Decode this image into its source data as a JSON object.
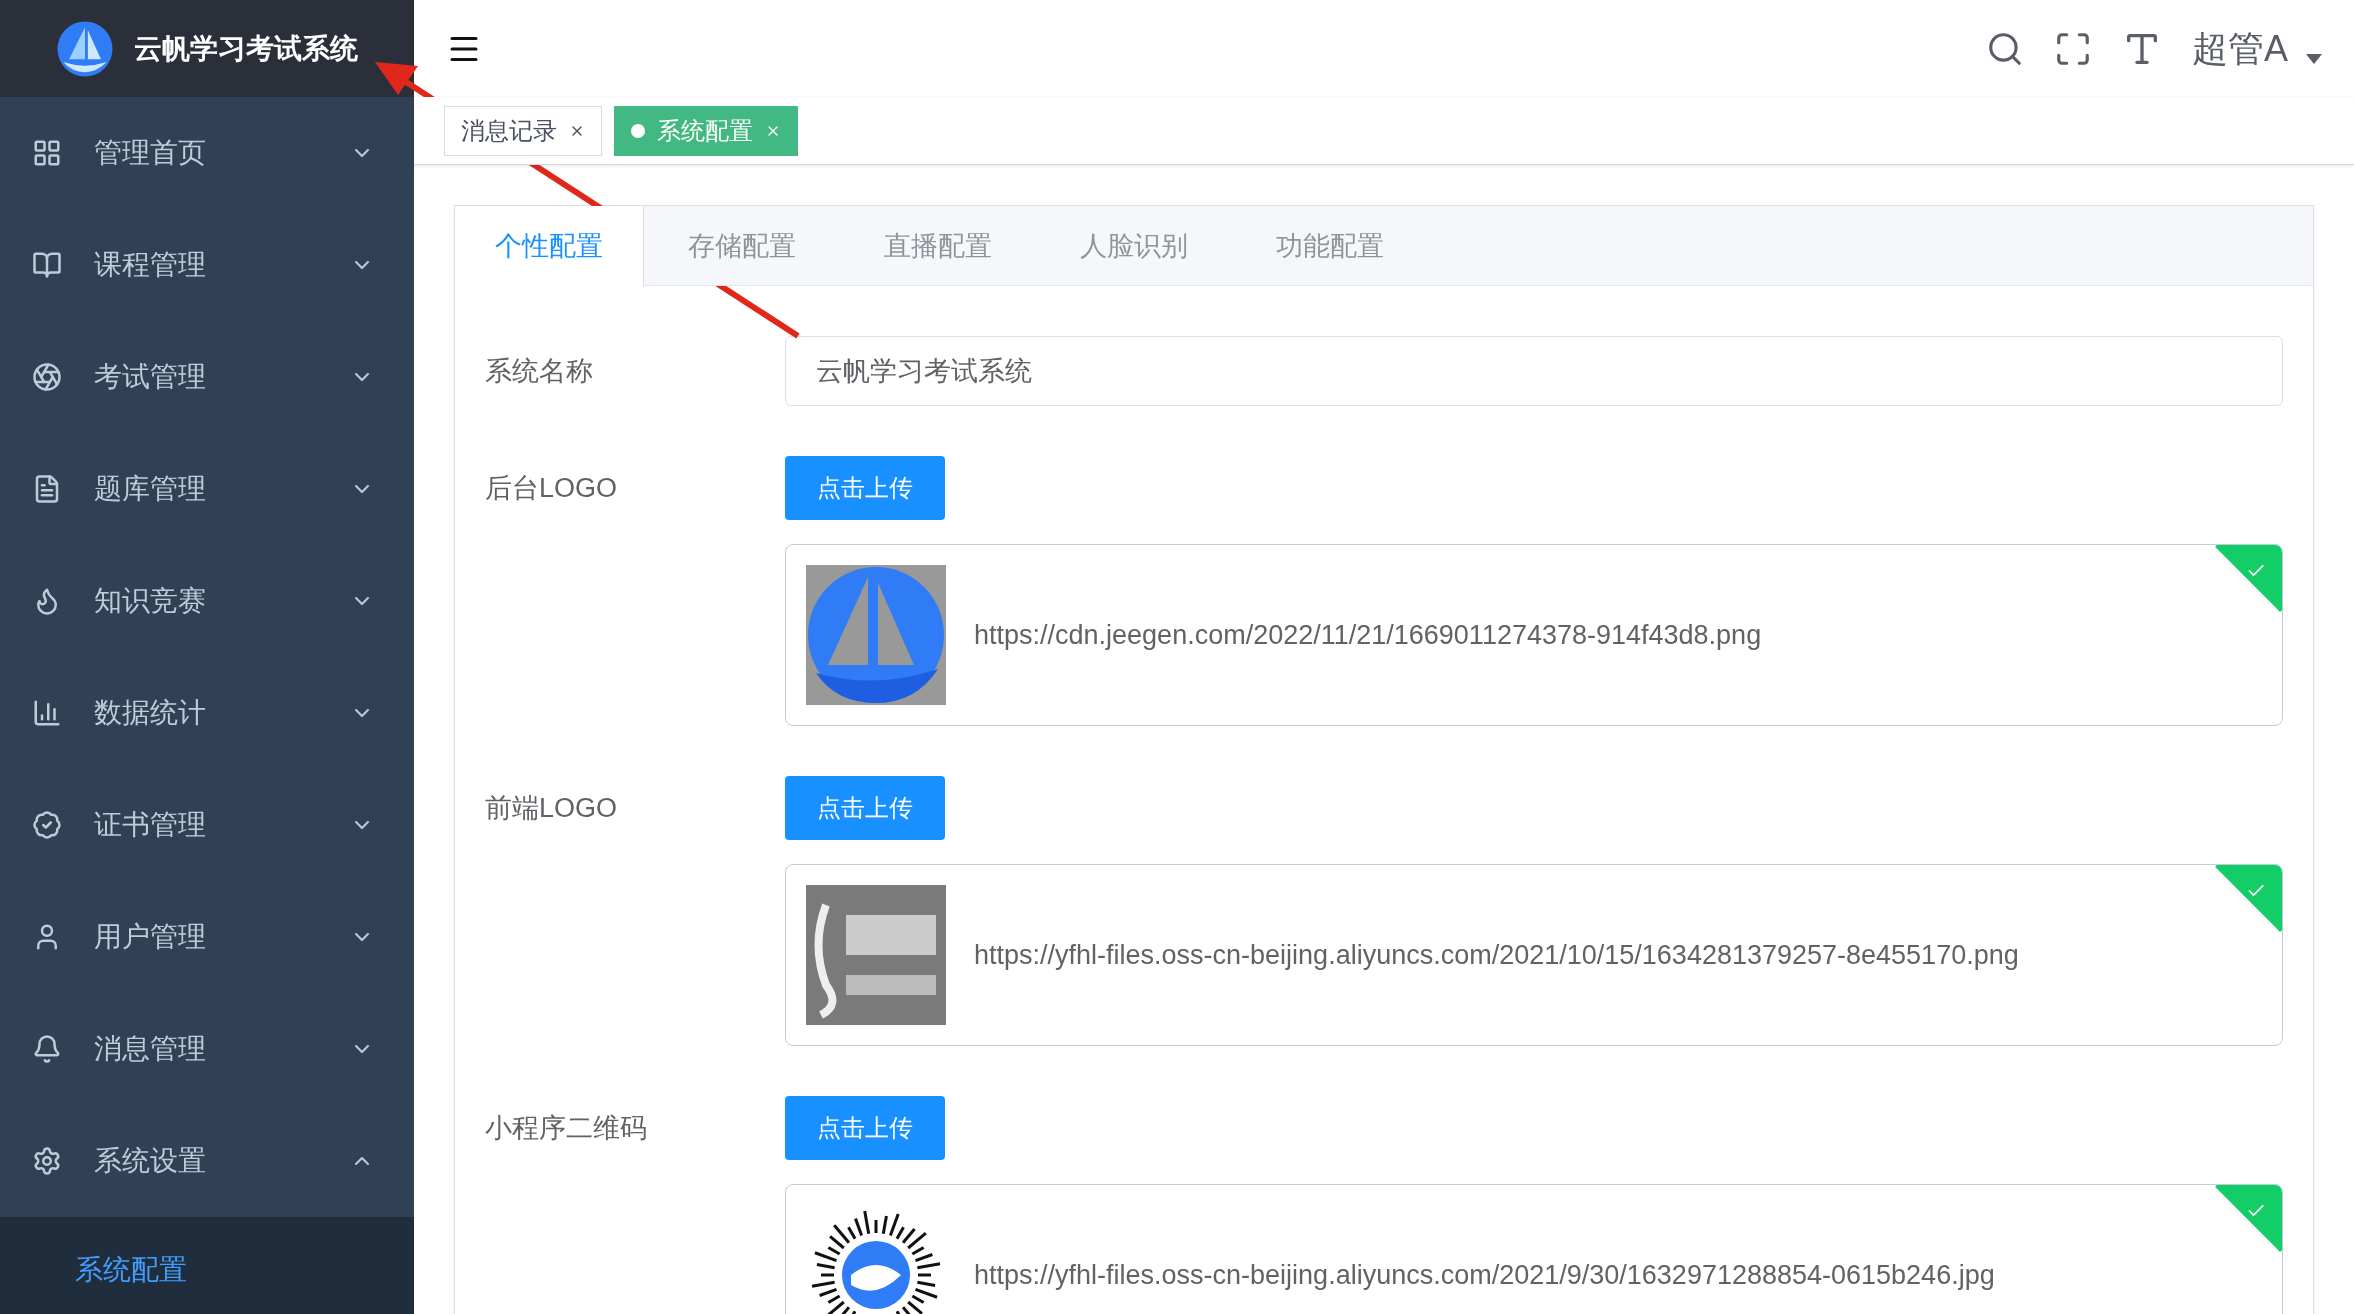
{
  "sidebar": {
    "title": "云帆学习考试系统",
    "items": [
      {
        "label": "管理首页",
        "expanded": false
      },
      {
        "label": "课程管理",
        "expanded": false
      },
      {
        "label": "考试管理",
        "expanded": false
      },
      {
        "label": "题库管理",
        "expanded": false
      },
      {
        "label": "知识竞赛",
        "expanded": false
      },
      {
        "label": "数据统计",
        "expanded": false
      },
      {
        "label": "证书管理",
        "expanded": false
      },
      {
        "label": "用户管理",
        "expanded": false
      },
      {
        "label": "消息管理",
        "expanded": false
      },
      {
        "label": "系统设置",
        "expanded": true,
        "children": [
          {
            "label": "系统配置",
            "selected": true
          }
        ]
      }
    ]
  },
  "header": {
    "user": "超管A"
  },
  "tags": [
    {
      "label": "消息记录",
      "selected": false
    },
    {
      "label": "系统配置",
      "selected": true
    }
  ],
  "tabs": [
    {
      "label": "个性配置",
      "selected": true
    },
    {
      "label": "存储配置",
      "selected": false
    },
    {
      "label": "直播配置",
      "selected": false
    },
    {
      "label": "人脸识别",
      "selected": false
    },
    {
      "label": "功能配置",
      "selected": false
    }
  ],
  "form": [
    {
      "kind": "text",
      "label": "系统名称",
      "value": "云帆学习考试系统"
    },
    {
      "kind": "upload",
      "label": "后台LOGO",
      "button": "点击上传",
      "file": {
        "url": "https://cdn.jeegen.com/2022/11/21/1669011274378-914f43d8.png",
        "uploaded": true
      }
    },
    {
      "kind": "upload",
      "label": "前端LOGO",
      "button": "点击上传",
      "file": {
        "url": "https://yfhl-files.oss-cn-beijing.aliyuncs.com/2021/10/15/1634281379257-8e455170.png",
        "uploaded": true
      }
    },
    {
      "kind": "upload",
      "label": "小程序二维码",
      "button": "点击上传",
      "file": {
        "url": "https://yfhl-files.oss-cn-beijing.aliyuncs.com/2021/9/30/1632971288854-0615b246.jpg",
        "uploaded": true
      }
    }
  ]
}
